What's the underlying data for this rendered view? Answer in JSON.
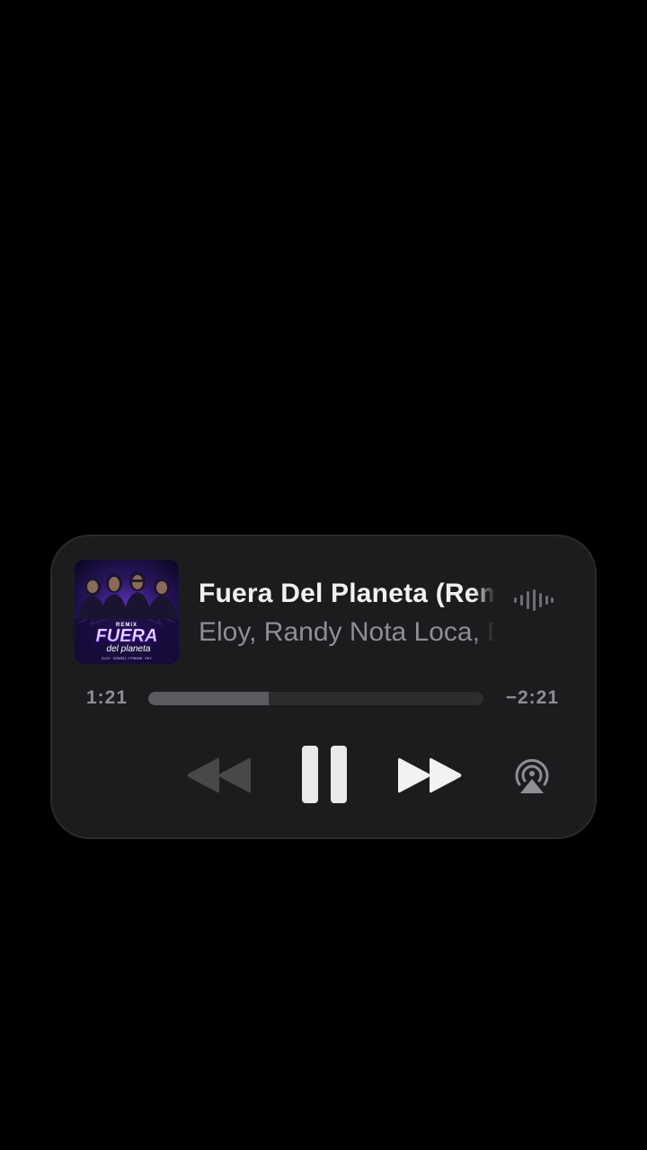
{
  "now_playing": {
    "track_title": "Fuera Del Planeta (Remix)",
    "artist": "Eloy, Randy Nota Loca, Dowell, Pinwin & Dey",
    "artwork": {
      "badge": "REMIX",
      "title_line1": "FUERA",
      "title_line2": "del planeta",
      "credits": "ELOY · DOWELL Y PINWIN · DEY"
    },
    "elapsed": "1:21",
    "remaining": "−2:21",
    "progress": 0.36
  },
  "controls": {
    "rewind": "rewind-icon",
    "pause": "pause-icon",
    "forward": "fast-forward-icon",
    "airplay": "airplay-icon",
    "waveform": "waveform-icon"
  },
  "colors": {
    "background": "#000000",
    "card": "#1c1c1e",
    "title": "#f2f2f2",
    "secondary": "#8e8e93",
    "accent_purple": "#7b2cff"
  }
}
